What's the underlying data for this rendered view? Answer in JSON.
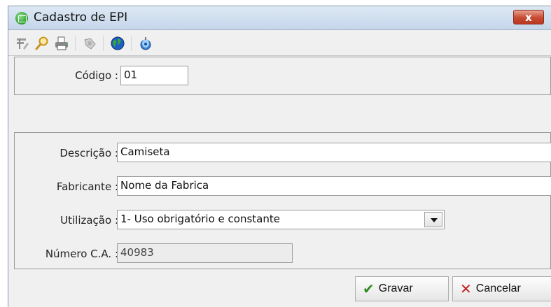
{
  "window": {
    "title": "Cadastro de EPI",
    "close_label": "x"
  },
  "toolbar": {
    "icons": [
      "edit-icon",
      "search-icon",
      "print-icon",
      "tools-icon",
      "globe-icon",
      "help-icon"
    ]
  },
  "codigo": {
    "label": "Código :",
    "value": "01"
  },
  "form": {
    "descricao": {
      "label": "Descrição :",
      "value": "Camiseta"
    },
    "fabricante": {
      "label": "Fabricante :",
      "value": "Nome da Fabrica"
    },
    "utilizacao": {
      "label": "Utilização :",
      "value": "1- Uso obrigatório e constante"
    },
    "numero_ca": {
      "label": "Número C.A. :",
      "value": "40983"
    }
  },
  "buttons": {
    "save_label": "Gravar",
    "cancel_label": "Cancelar"
  },
  "colors": {
    "save_check": "#2e8b1f",
    "cancel_x": "#c62020"
  }
}
